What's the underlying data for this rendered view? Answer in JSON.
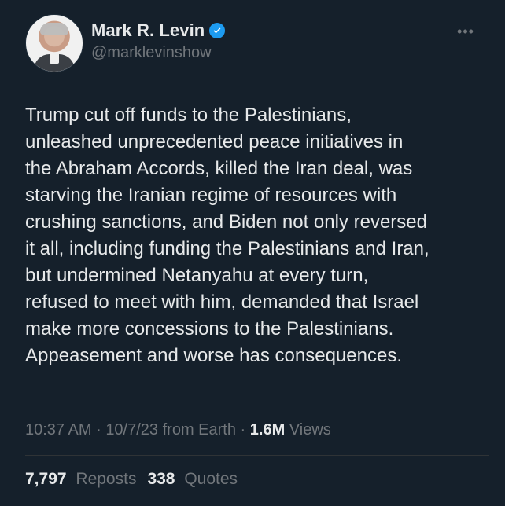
{
  "user": {
    "display_name": "Mark R. Levin",
    "handle": "@marklevinshow"
  },
  "icons": {
    "verified": "verified-badge-icon",
    "more": "more-horizontal-icon"
  },
  "tweet": {
    "text": "Trump cut off funds to the Palestinians,\nunleashed unprecedented peace initiatives in\nthe Abraham Accords, killed the Iran deal, was\nstarving the Iranian regime of resources with\ncrushing sanctions, and Biden not only reversed\nit all, including funding the Palestinians and Iran,\nbut undermined Netanyahu at every turn,\nrefused to meet with him, demanded that Israel\nmake more concessions to the Palestinians.\nAppeasement and worse has consequences."
  },
  "meta": {
    "time": "10:37 AM",
    "date": "10/7/23",
    "source": "from Earth",
    "views_count": "1.6M",
    "views_label": "Views",
    "separator": "·"
  },
  "stats": {
    "reposts_count": "7,797",
    "reposts_label": "Reposts",
    "quotes_count": "338",
    "quotes_label": "Quotes"
  },
  "colors": {
    "background": "#15202b",
    "text": "#e7e9ea",
    "muted": "#71767b",
    "verified": "#1d9bf0"
  }
}
